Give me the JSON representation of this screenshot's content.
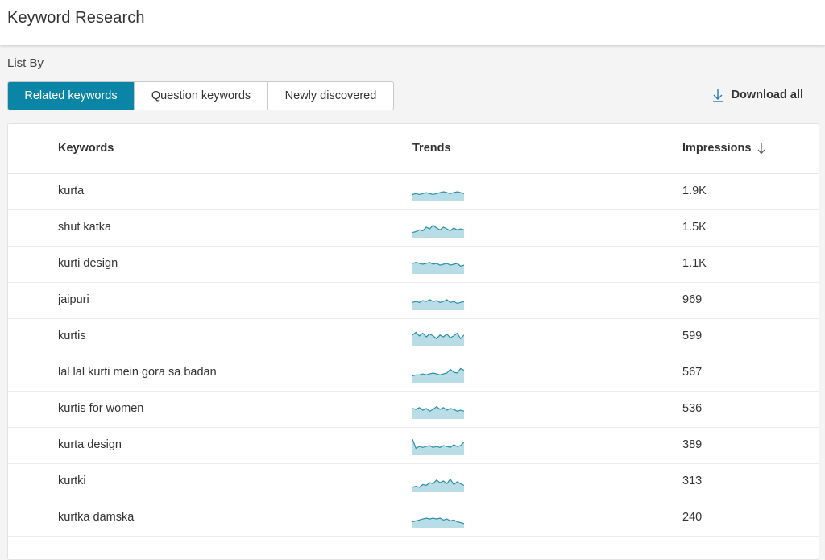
{
  "header": {
    "title": "Keyword Research"
  },
  "list_by": {
    "label": "List By",
    "tabs": [
      {
        "label": "Related keywords",
        "active": true
      },
      {
        "label": "Question keywords",
        "active": false
      },
      {
        "label": "Newly discovered",
        "active": false
      }
    ]
  },
  "download": {
    "label": "Download all",
    "icon": "download-icon"
  },
  "table": {
    "columns": {
      "keywords": "Keywords",
      "trends": "Trends",
      "impressions": "Impressions",
      "sort_icon": "arrow-down-icon"
    },
    "rows": [
      {
        "keyword": "kurta",
        "impressions": "1.9K",
        "trend": [
          5,
          6,
          5,
          6,
          7,
          6,
          5,
          6,
          7,
          8,
          7,
          6,
          7,
          8,
          7,
          6
        ]
      },
      {
        "keyword": "shut katka",
        "impressions": "1.5K",
        "trend": [
          3,
          4,
          6,
          5,
          9,
          7,
          11,
          8,
          6,
          9,
          7,
          5,
          8,
          6,
          7,
          6
        ]
      },
      {
        "keyword": "kurti design",
        "impressions": "1.1K",
        "trend": [
          9,
          10,
          9,
          8,
          9,
          10,
          8,
          9,
          7,
          8,
          9,
          7,
          8,
          9,
          6,
          7
        ]
      },
      {
        "keyword": "jaipuri",
        "impressions": "969",
        "trend": [
          6,
          7,
          6,
          8,
          7,
          9,
          7,
          8,
          6,
          7,
          9,
          6,
          7,
          5,
          6,
          7
        ]
      },
      {
        "keyword": "kurtis",
        "impressions": "599",
        "trend": [
          10,
          13,
          9,
          12,
          8,
          11,
          9,
          6,
          10,
          8,
          11,
          7,
          9,
          12,
          6,
          10
        ]
      },
      {
        "keyword": "lal lal kurti mein gora sa badan",
        "impressions": "567",
        "trend": [
          5,
          6,
          6,
          7,
          6,
          7,
          8,
          7,
          6,
          7,
          8,
          12,
          9,
          8,
          13,
          11
        ]
      },
      {
        "keyword": "kurtis for women",
        "impressions": "536",
        "trend": [
          9,
          8,
          10,
          7,
          9,
          6,
          8,
          11,
          8,
          10,
          7,
          9,
          8,
          6,
          7,
          6
        ]
      },
      {
        "keyword": "kurta design",
        "impressions": "389",
        "trend": [
          15,
          5,
          7,
          6,
          7,
          8,
          6,
          7,
          6,
          8,
          7,
          6,
          9,
          7,
          8,
          12
        ]
      },
      {
        "keyword": "kurtki",
        "impressions": "313",
        "trend": [
          2,
          3,
          2,
          5,
          4,
          7,
          6,
          10,
          7,
          9,
          6,
          11,
          5,
          8,
          6,
          4
        ]
      },
      {
        "keyword": "kurtka damska",
        "impressions": "240",
        "trend": [
          4,
          5,
          6,
          7,
          8,
          7,
          8,
          7,
          8,
          6,
          7,
          5,
          6,
          4,
          3,
          2
        ]
      }
    ]
  },
  "colors": {
    "accent": "#0a85a5",
    "trend_line": "#2a8ea6",
    "trend_fill": "#b9dde7"
  }
}
